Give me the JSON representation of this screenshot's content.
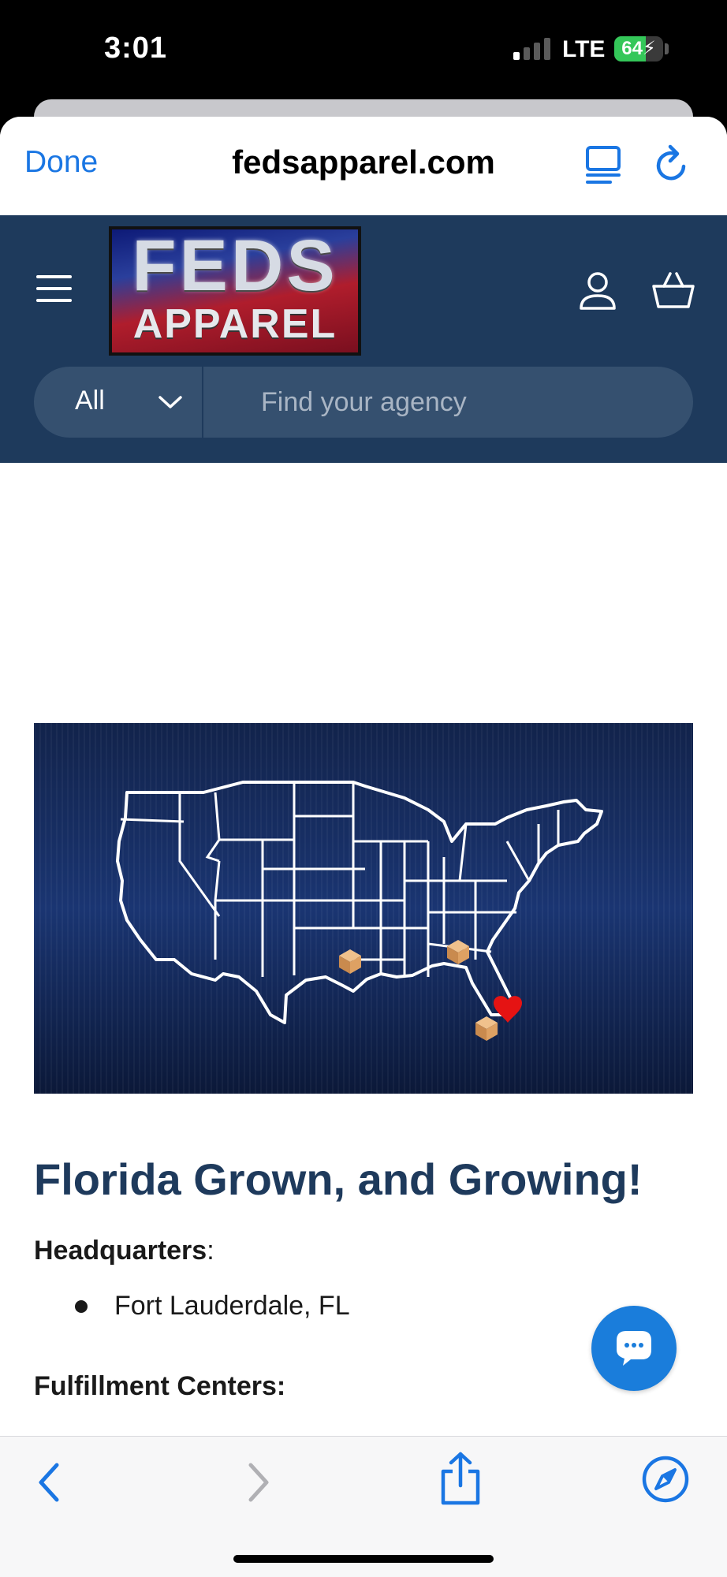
{
  "status_bar": {
    "time": "3:01",
    "network": "LTE",
    "battery_percent": "64",
    "battery_level": 0.64
  },
  "browser": {
    "done_label": "Done",
    "url": "fedsapparel.com",
    "icons": {
      "reader": "reader-view-icon",
      "reload": "reload-icon"
    }
  },
  "site_header": {
    "logo": {
      "line1": "FEDS",
      "line2": "APPAREL"
    },
    "icons": {
      "menu": "hamburger-menu-icon",
      "account": "account-icon",
      "cart": "cart-icon"
    },
    "search": {
      "category": "All",
      "placeholder": "Find your agency"
    }
  },
  "content": {
    "headline": "Florida Grown, and Growing!",
    "headquarters_label": "Headquarters",
    "headquarters_colon": ":",
    "headquarters_items": [
      "Fort Lauderdale, FL"
    ],
    "fulfillment_label": "Fulfillment Centers:"
  },
  "colors": {
    "accent": "#1a76e3",
    "header_bg": "#1e3a5c",
    "headline": "#1e3a5c",
    "chat": "#1a7ddb"
  },
  "toolbar": {
    "icons": [
      "back-icon",
      "forward-icon",
      "share-icon",
      "safari-compass-icon"
    ]
  }
}
